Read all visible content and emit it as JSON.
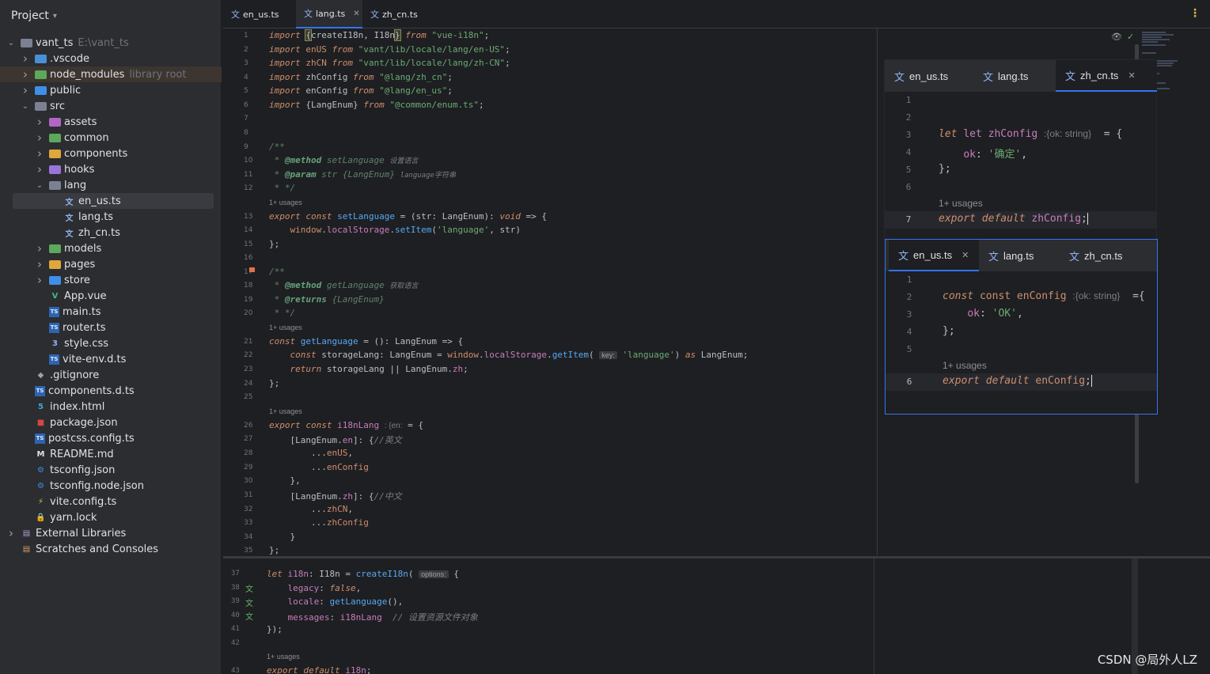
{
  "project": {
    "title": "Project",
    "tree": [
      {
        "depth": 0,
        "arrow": "down",
        "icon": "folder",
        "color": "#7b8192",
        "label": "vant_ts",
        "secondary": "E:\\vant_ts"
      },
      {
        "depth": 1,
        "arrow": "right",
        "icon": "folder",
        "color": "#4a8fd6",
        "label": ".vscode",
        "secondary": ""
      },
      {
        "depth": 1,
        "arrow": "right",
        "icon": "folder",
        "color": "#5ca85c",
        "label": "node_modules",
        "secondary": "library root",
        "highlight": "nm"
      },
      {
        "depth": 1,
        "arrow": "right",
        "icon": "folder",
        "color": "#3f8fe8",
        "label": "public",
        "secondary": ""
      },
      {
        "depth": 1,
        "arrow": "down",
        "icon": "folder",
        "color": "#7b8192",
        "label": "src",
        "secondary": ""
      },
      {
        "depth": 2,
        "arrow": "right",
        "icon": "folder",
        "color": "#b266c4",
        "label": "assets",
        "secondary": ""
      },
      {
        "depth": 2,
        "arrow": "right",
        "icon": "folder",
        "color": "#5ca85c",
        "label": "common",
        "secondary": ""
      },
      {
        "depth": 2,
        "arrow": "right",
        "icon": "folder",
        "color": "#e0a83a",
        "label": "components",
        "secondary": ""
      },
      {
        "depth": 2,
        "arrow": "right",
        "icon": "folder",
        "color": "#9a74d8",
        "label": "hooks",
        "secondary": ""
      },
      {
        "depth": 2,
        "arrow": "down",
        "icon": "folder",
        "color": "#7b8192",
        "label": "lang",
        "secondary": ""
      },
      {
        "depth": 3,
        "arrow": "",
        "icon": "translate",
        "color": "#8fb4f5",
        "label": "en_us.ts",
        "secondary": "",
        "selected": true
      },
      {
        "depth": 3,
        "arrow": "",
        "icon": "translate",
        "color": "#8fb4f5",
        "label": "lang.ts",
        "secondary": ""
      },
      {
        "depth": 3,
        "arrow": "",
        "icon": "translate",
        "color": "#8fb4f5",
        "label": "zh_cn.ts",
        "secondary": ""
      },
      {
        "depth": 2,
        "arrow": "right",
        "icon": "folder",
        "color": "#5ca85c",
        "label": "models",
        "secondary": ""
      },
      {
        "depth": 2,
        "arrow": "right",
        "icon": "folder",
        "color": "#e0a83a",
        "label": "pages",
        "secondary": ""
      },
      {
        "depth": 2,
        "arrow": "right",
        "icon": "folder",
        "color": "#3f8fe8",
        "label": "store",
        "secondary": ""
      },
      {
        "depth": 2,
        "arrow": "",
        "icon": "vue",
        "color": "#42b883",
        "label": "App.vue",
        "secondary": ""
      },
      {
        "depth": 2,
        "arrow": "",
        "icon": "ts",
        "color": "#3f8fe8",
        "label": "main.ts",
        "secondary": ""
      },
      {
        "depth": 2,
        "arrow": "",
        "icon": "ts",
        "color": "#3f8fe8",
        "label": "router.ts",
        "secondary": ""
      },
      {
        "depth": 2,
        "arrow": "",
        "icon": "css",
        "color": "#8fb4f5",
        "label": "style.css",
        "secondary": ""
      },
      {
        "depth": 2,
        "arrow": "",
        "icon": "ts",
        "color": "#3f8fe8",
        "label": "vite-env.d.ts",
        "secondary": ""
      },
      {
        "depth": 1,
        "arrow": "",
        "icon": "git",
        "color": "#9da0a8",
        "label": ".gitignore",
        "secondary": ""
      },
      {
        "depth": 1,
        "arrow": "",
        "icon": "ts",
        "color": "#3f8fe8",
        "label": "components.d.ts",
        "secondary": ""
      },
      {
        "depth": 1,
        "arrow": "",
        "icon": "html",
        "color": "#3fa7d6",
        "label": "index.html",
        "secondary": ""
      },
      {
        "depth": 1,
        "arrow": "",
        "icon": "npm",
        "color": "#d64545",
        "label": "package.json",
        "secondary": ""
      },
      {
        "depth": 1,
        "arrow": "",
        "icon": "ts",
        "color": "#3f8fe8",
        "label": "postcss.config.ts",
        "secondary": ""
      },
      {
        "depth": 1,
        "arrow": "",
        "icon": "md",
        "color": "#dfe1e5",
        "label": "README.md",
        "secondary": ""
      },
      {
        "depth": 1,
        "arrow": "",
        "icon": "gear",
        "color": "#3f8fe8",
        "label": "tsconfig.json",
        "secondary": ""
      },
      {
        "depth": 1,
        "arrow": "",
        "icon": "gear",
        "color": "#3f8fe8",
        "label": "tsconfig.node.json",
        "secondary": ""
      },
      {
        "depth": 1,
        "arrow": "",
        "icon": "vite",
        "color": "#e0c33a",
        "label": "vite.config.ts",
        "secondary": ""
      },
      {
        "depth": 1,
        "arrow": "",
        "icon": "lock",
        "color": "#e04545",
        "label": "yarn.lock",
        "secondary": ""
      },
      {
        "depth": 0,
        "arrow": "right",
        "icon": "lib",
        "color": "#b49bd6",
        "label": "External Libraries",
        "secondary": ""
      },
      {
        "depth": 0,
        "arrow": "",
        "icon": "scratch",
        "color": "#d6a05c",
        "label": "Scratches and Consoles",
        "secondary": ""
      }
    ]
  },
  "editor": {
    "tabs": [
      {
        "label": "en_us.ts",
        "active": false,
        "close": false
      },
      {
        "label": "lang.ts",
        "active": true,
        "close": true
      },
      {
        "label": "zh_cn.ts",
        "active": false,
        "close": false
      }
    ],
    "usages_label": "1+ usages",
    "hint_key": "key:",
    "hint_options": "options:",
    "inlay_en": ": {en:",
    "code": {
      "l1": "import {createI18n, I18n} from \"vue-i18n\";",
      "l2": "import enUS from \"vant/lib/locale/lang/en-US\";",
      "l3": "import zhCN from \"vant/lib/locale/lang/zh-CN\";",
      "l4": "import zhConfig from \"@lang/zh_cn\";",
      "l5": "import enConfig from \"@lang/en_us\";",
      "l6": "import {LangEnum} from \"@common/enum.ts\";",
      "l9": "/**",
      "l10_tag": "@method",
      "l10_name": "setLanguage",
      "l10_desc": "设置语言",
      "l11_tag": "@param",
      "l11_name": "str {LangEnum}",
      "l11_desc": "language字符串",
      "l12": " * */",
      "l13": "export const setLanguage = (str: LangEnum): void => {",
      "l14": "    window.localStorage.setItem('language', str)",
      "l15": "};",
      "l17": "/**",
      "l18_tag": "@method",
      "l18_name": "getLanguage",
      "l18_desc": "获取语言",
      "l19_tag": "@returns",
      "l19_name": "{LangEnum}",
      "l20": " * */",
      "l21": "const getLanguage = (): LangEnum => {",
      "l22a": "    const storageLang: LangEnum = window.localStorage.getItem(",
      "l22b": "'language') as LangEnum;",
      "l23": "    return storageLang || LangEnum.zh;",
      "l24": "};",
      "l26": "export const i18nLang",
      "l26b": " = {",
      "l27": "    [LangEnum.en]: {//英文",
      "l28": "        ...enUS,",
      "l29": "        ...enConfig",
      "l30": "    },",
      "l31": "    [LangEnum.zh]: {//中文",
      "l32": "        ...zhCN,",
      "l33": "        ...zhConfig",
      "l34": "    }",
      "l35": "};"
    }
  },
  "popup_zh": {
    "tabs": [
      {
        "label": "en_us.ts",
        "active": false,
        "close": false
      },
      {
        "label": "lang.ts",
        "active": false,
        "close": false
      },
      {
        "label": "zh_cn.ts",
        "active": true,
        "close": true
      }
    ],
    "l3a": "let zhConfig",
    "l3hint": ":{ok: string}",
    "l3b": " = {",
    "l4": "    ok: '确定',",
    "l5": "};",
    "usages": "1+ usages",
    "l7": "export default zhConfig;"
  },
  "popup_en": {
    "tabs": [
      {
        "label": "en_us.ts",
        "active": true,
        "close": true
      },
      {
        "label": "lang.ts",
        "active": false,
        "close": false
      },
      {
        "label": "zh_cn.ts",
        "active": false,
        "close": false
      }
    ],
    "l2a": "const enConfig",
    "l2hint": ":{ok: string}",
    "l2b": " ={",
    "l3": "    ok: 'OK',",
    "l4": "};",
    "usages": "1+ usages",
    "l6": "export default enConfig;"
  },
  "bottom": {
    "l37a": "let i18n: I18n = createI18n(",
    "l37b": " {",
    "l38": "    legacy: false,",
    "l39": "    locale: getLanguage(),",
    "l40a": "    messages: i18nLang",
    "l40b": " // 设置资源文件对象",
    "l41": "});",
    "usages": "1+ usages",
    "l43": "export default i18n;"
  },
  "watermark": "CSDN @局外人LZ"
}
